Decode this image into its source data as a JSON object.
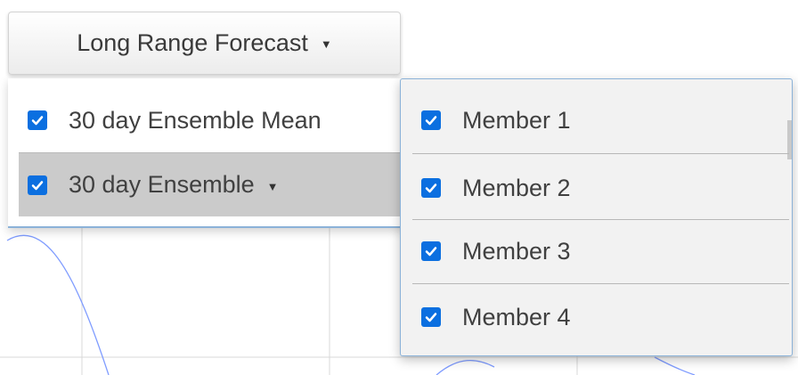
{
  "toolbar": {
    "forecast_button_label": "Long Range Forecast"
  },
  "menu": {
    "items": [
      {
        "label": "30 day Ensemble Mean",
        "checked": true,
        "has_submenu": false
      },
      {
        "label": "30 day Ensemble",
        "checked": true,
        "has_submenu": true,
        "highlighted": true
      }
    ]
  },
  "submenu": {
    "items": [
      {
        "label": "Member 1",
        "checked": true
      },
      {
        "label": "Member 2",
        "checked": true
      },
      {
        "label": "Member 3",
        "checked": true
      },
      {
        "label": "Member 4",
        "checked": true
      }
    ]
  },
  "colors": {
    "checkbox": "#0b6fe0",
    "highlight": "#cbcbcb",
    "border_accent": "#8bb2d8",
    "chart_line": "#7f9cff",
    "grid": "#d8d8d8"
  },
  "icons": {
    "dropdown": "caret-down-icon",
    "checked": "checkmark-icon"
  }
}
